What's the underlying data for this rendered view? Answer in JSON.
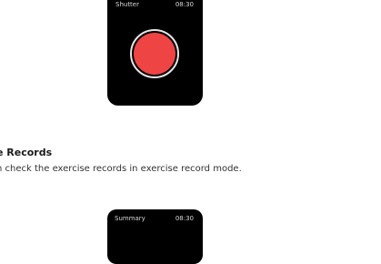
{
  "shutter_screen": {
    "title": "Shutter",
    "time": "08:30",
    "record_button_color": "#ef4444"
  },
  "exercise_records": {
    "heading": "e Records",
    "body": "n check the exercise records in exercise  record mode."
  },
  "summary_screen": {
    "title": "Summary",
    "time": "08:30"
  }
}
